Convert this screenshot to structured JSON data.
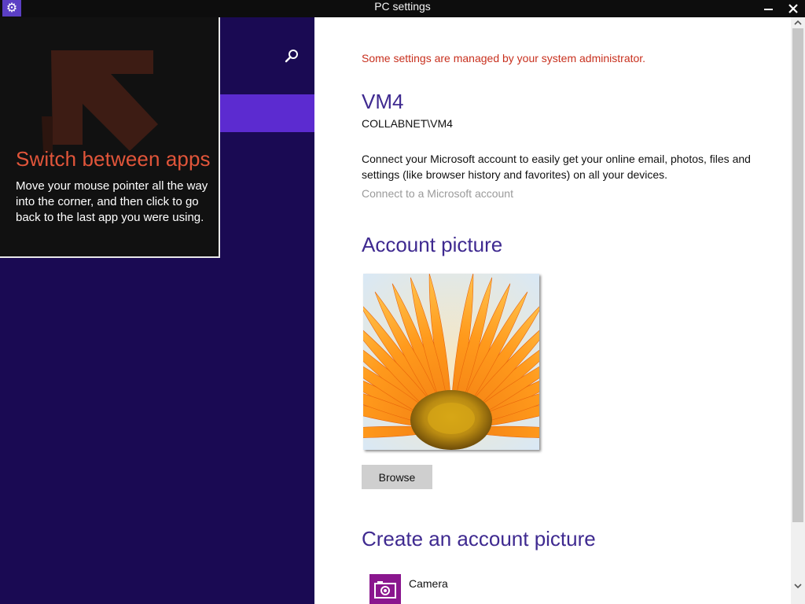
{
  "window": {
    "title": "PC settings",
    "app_icon": "gear-icon",
    "controls": {
      "minimize": "minimize-icon",
      "close": "close-icon"
    }
  },
  "nav": {
    "search_icon": "search-icon",
    "selected_color": "#5c2bd0",
    "background_color": "#1a0a53"
  },
  "tip": {
    "title": "Switch between apps",
    "body": "Move your mouse pointer all the way into the corner, and then click to go back to the last app you were using.",
    "title_color": "#e1553a",
    "arrow_icon": "corner-arrow-icon"
  },
  "account": {
    "admin_notice": "Some settings are managed by your system administrator.",
    "name": "VM4",
    "domain": "COLLABNET\\VM4",
    "description": "Connect your Microsoft account to easily get your online email, photos, files and settings (like browser history and favorites) on all your devices.",
    "connect_link": "Connect to a Microsoft account"
  },
  "account_picture": {
    "heading": "Account picture",
    "browse_label": "Browse"
  },
  "create_picture": {
    "heading": "Create an account picture",
    "apps": [
      {
        "label": "Camera",
        "icon": "camera-icon",
        "color": "#8a168e"
      }
    ]
  },
  "colors": {
    "heading": "#3f2a90",
    "notice": "#c8301e",
    "link_disabled": "#9a9a9a"
  }
}
